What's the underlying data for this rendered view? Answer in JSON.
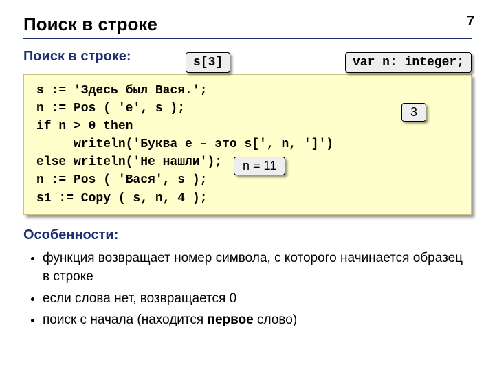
{
  "page_number": "7",
  "title": "Поиск в строке",
  "subtitle": "Поиск в строке:",
  "pills": {
    "s3": "s[3]",
    "vardecl": "var n: integer;",
    "three": "3",
    "n11": "n = 11"
  },
  "code": "s := 'Здесь был Вася.';\nn := Pos ( 'е', s );\nif n > 0 then\n     writeln('Буква е – это s[', n, ']')\nelse writeln('Не нашли');\nn := Pos ( 'Вася', s );\ns1 := Copy ( s, n, 4 );",
  "features_label": "Особенности:",
  "features": {
    "f1": "функция возвращает номер символа, с которого начинается образец в строке",
    "f2": "если слова нет, возвращается 0",
    "f3_a": "поиск с начала (находится ",
    "f3_b": "первое",
    "f3_c": " слово)"
  }
}
